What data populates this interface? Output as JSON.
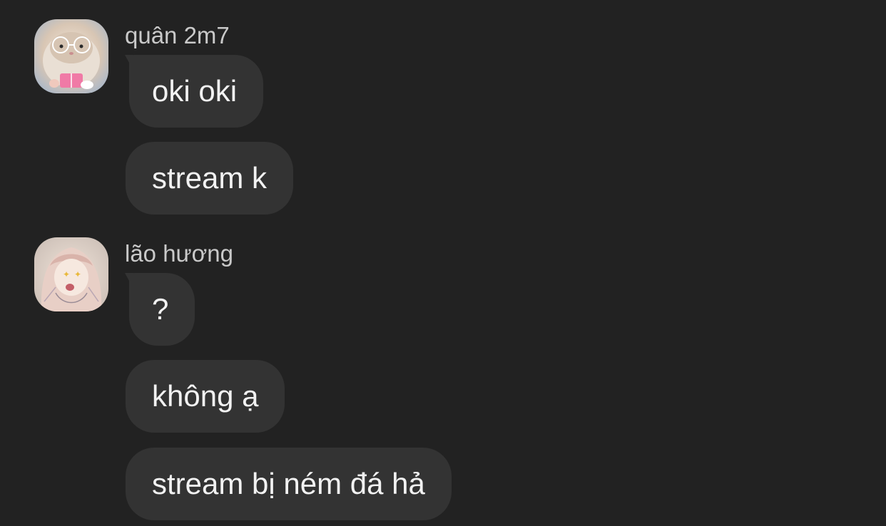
{
  "messages_groups": [
    {
      "sender": "quân 2m7",
      "avatar_icon": "hamster-with-glasses-avatar",
      "messages": [
        "oki oki",
        "stream k"
      ]
    },
    {
      "sender": "lão hương",
      "avatar_icon": "anime-girl-avatar",
      "messages": [
        "?",
        "không ạ",
        "stream bị ném đá hả"
      ]
    }
  ],
  "colors": {
    "background": "#222222",
    "bubble": "#333333",
    "text": "#f2f2f2",
    "sender": "#c9c9c9"
  }
}
